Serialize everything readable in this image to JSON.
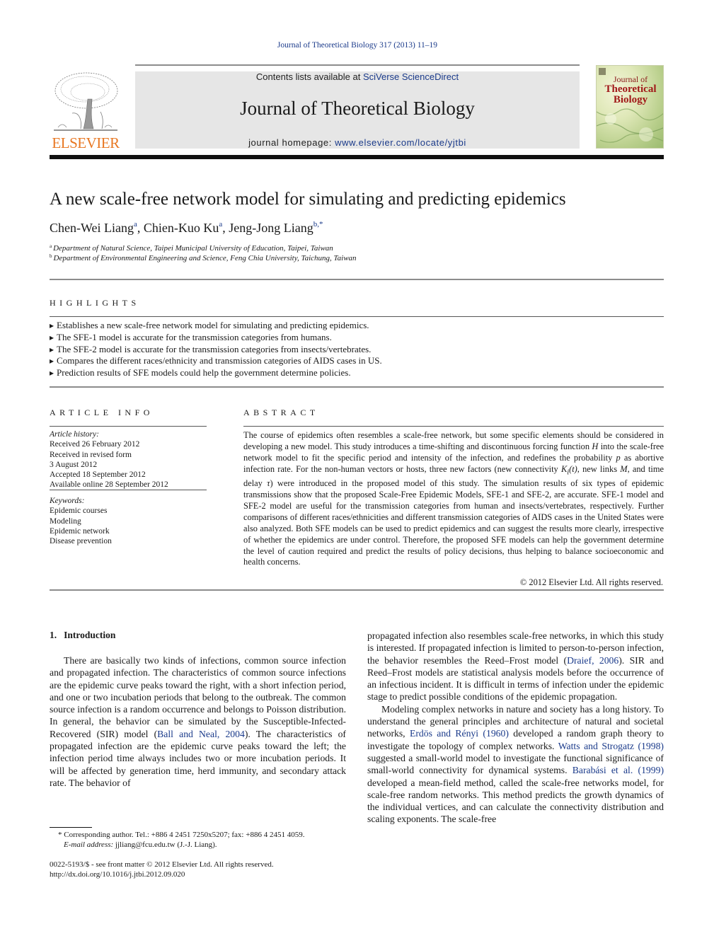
{
  "running_head": "Journal of Theoretical Biology 317 (2013) 11–19",
  "masthead": {
    "publisher_logo_text": "ELSEVIER",
    "contents_prefix": "Contents lists available at ",
    "contents_link": "SciVerse ScienceDirect",
    "journal_name": "Journal of Theoretical Biology",
    "homepage_prefix": "journal homepage: ",
    "homepage_link": "www.elsevier.com/locate/yjtbi",
    "cover": {
      "line1": "Journal of",
      "line2": "Theoretical",
      "line3": "Biology"
    }
  },
  "colors": {
    "link": "#1a3a8a",
    "elsevier_orange": "#e87722",
    "masthead_panel": "#e6e6e6",
    "cover_title": "#a01818"
  },
  "article": {
    "title": "A new scale-free network model for simulating and predicting epidemics",
    "authors": [
      {
        "name": "Chen-Wei Liang",
        "sup": "a"
      },
      {
        "name": "Chien-Kuo Ku",
        "sup": "a"
      },
      {
        "name": "Jeng-Jong Liang",
        "sup": "b,*"
      }
    ],
    "affiliations": [
      {
        "key": "a",
        "text": "Department of Natural Science, Taipei Municipal University of Education, Taipei, Taiwan"
      },
      {
        "key": "b",
        "text": "Department of Environmental Engineering and Science, Feng Chia University, Taichung, Taiwan"
      }
    ]
  },
  "highlights": {
    "heading": "HIGHLIGHTS",
    "items": [
      "Establishes a new scale-free network model for simulating and predicting epidemics.",
      "The SFE-1 model is accurate for the transmission categories from humans.",
      "The SFE-2 model is accurate for the transmission categories from insects/vertebrates.",
      "Compares the different races/ethnicity and transmission categories of AIDS cases in US.",
      "Prediction results of SFE models could help the government determine policies."
    ]
  },
  "article_info": {
    "heading": "ARTICLE INFO",
    "history_label": "Article history:",
    "history": [
      "Received 26 February 2012",
      "Received in revised form",
      "3 August 2012",
      "Accepted 18 September 2012",
      "Available online 28 September 2012"
    ],
    "keywords_label": "Keywords:",
    "keywords": [
      "Epidemic courses",
      "Modeling",
      "Epidemic network",
      "Disease prevention"
    ]
  },
  "abstract": {
    "heading": "ABSTRACT",
    "parts": {
      "p1": "The course of epidemics often resembles a scale-free network, but some specific elements should be considered in developing a new model. This study introduces a time-shifting and discontinuous forcing function ",
      "H": "H",
      "p2": " into the scale-free network model to fit the specific period and intensity of the infection, and redefines the probability ",
      "p": "p",
      "p3": " as abortive infection rate. For the non-human vectors or hosts, three new factors (new connectivity ",
      "K": "K",
      "Ksub": "i",
      "Kt": "(t)",
      "p4": ", new links ",
      "M": "M",
      "p5": ", and time delay ",
      "tau": "τ",
      "p6": ") were introduced in the proposed model of this study. The simulation results of six types of epidemic transmissions show that the proposed Scale-Free Epidemic Models, SFE-1 and SFE-2, are accurate. SFE-1 model and SFE-2 model are useful for the transmission categories from human and insects/vertebrates, respectively. Further comparisons of different races/ethnicities and different transmission categories of AIDS cases in the United States were also analyzed. Both SFE models can be used to predict epidemics and can suggest the results more clearly, irrespective of whether the epidemics are under control. Therefore, the proposed SFE models can help the government determine the level of caution required and predict the results of policy decisions, thus helping to balance socioeconomic and health concerns."
    },
    "copyright": "© 2012 Elsevier Ltd. All rights reserved."
  },
  "body": {
    "section_number": "1.",
    "section_title": "Introduction",
    "left": {
      "t1": "There are basically two kinds of infections, common source infection and propagated infection. The characteristics of com­mon source infections are the epidemic curve peaks toward the right, with a short infection period, and one or two incubation periods that belong to the outbreak. The common source infection is a random occurrence and belongs to Poisson distribution. In general, the behavior can be simulated by the Susceptible-Infected-Recovered (SIR) model (",
      "ref1": "Ball and Neal, 2004",
      "t2": "). The char­acteristics of propagated infection are the epidemic curve peaks toward the left; the infection period time always includes two or more incubation periods. It will be affected by generation time, herd immunity, and secondary attack rate. The behavior of"
    },
    "right": {
      "t1": "propagated infection also resembles scale-free networks, in which this study is interested. If propagated infection is limited to person-to-person infection, the behavior resembles the Reed–Frost model (",
      "ref1": "Draief, 2006",
      "t2": "). SIR and Reed–Frost models are statistical analysis models before the occurrence of an infectious incident. It is difficult in terms of infection under the epidemic stage to predict possible conditions of the epidemic propagation.",
      "t3": "Modeling complex networks in nature and society has a long history. To understand the general principles and architecture of natural and societal networks, ",
      "ref2": "Erdös and Rényi (1960)",
      "t4": " developed a random graph theory to investigate the topology of complex networks. ",
      "ref3": "Watts and Strogatz (1998)",
      "t5": " suggested a small-world model to investigate the functional significance of small-world connectivity for dynamical systems. ",
      "ref4": "Barabási et al. (1999)",
      "t6": " devel­oped a mean-field method, called the scale-free networks model, for scale-free random networks. This method predicts the growth dynamics of the individual vertices, and can calculate the con­nectivity distribution and scaling exponents. The scale-free"
    }
  },
  "footnotes": {
    "corresponding": "* Corresponding author. Tel.: +886 4 2451 7250x5207; fax: +886 4 2451 4059.",
    "email_label": "E-mail address:",
    "email_value": " jjliang@fcu.edu.tw (J.-J. Liang).",
    "issn": "0022-5193/$ - see front matter © 2012 Elsevier Ltd. All rights reserved.",
    "doi": "http://dx.doi.org/10.1016/j.jtbi.2012.09.020"
  }
}
